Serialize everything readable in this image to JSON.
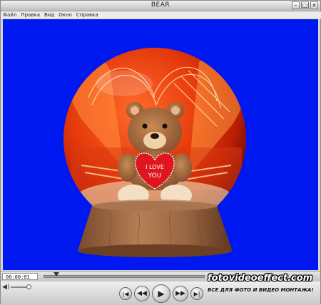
{
  "window": {
    "title": "BEAR"
  },
  "menu": [
    "Файл",
    "Правка",
    "Вид",
    "Окно",
    "Справка"
  ],
  "video": {
    "heart_text_line1": "I LOVE",
    "heart_text_line2": "YOU",
    "background_color": "#0018f0"
  },
  "player": {
    "current_time": "00:00:01",
    "playhead_fraction": 0.08
  },
  "watermark": {
    "brand": "fotovideoeffect.com",
    "tagline": "ВСЕ ДЛЯ ФОТО И ВИДЕО МОНТАЖА!"
  }
}
